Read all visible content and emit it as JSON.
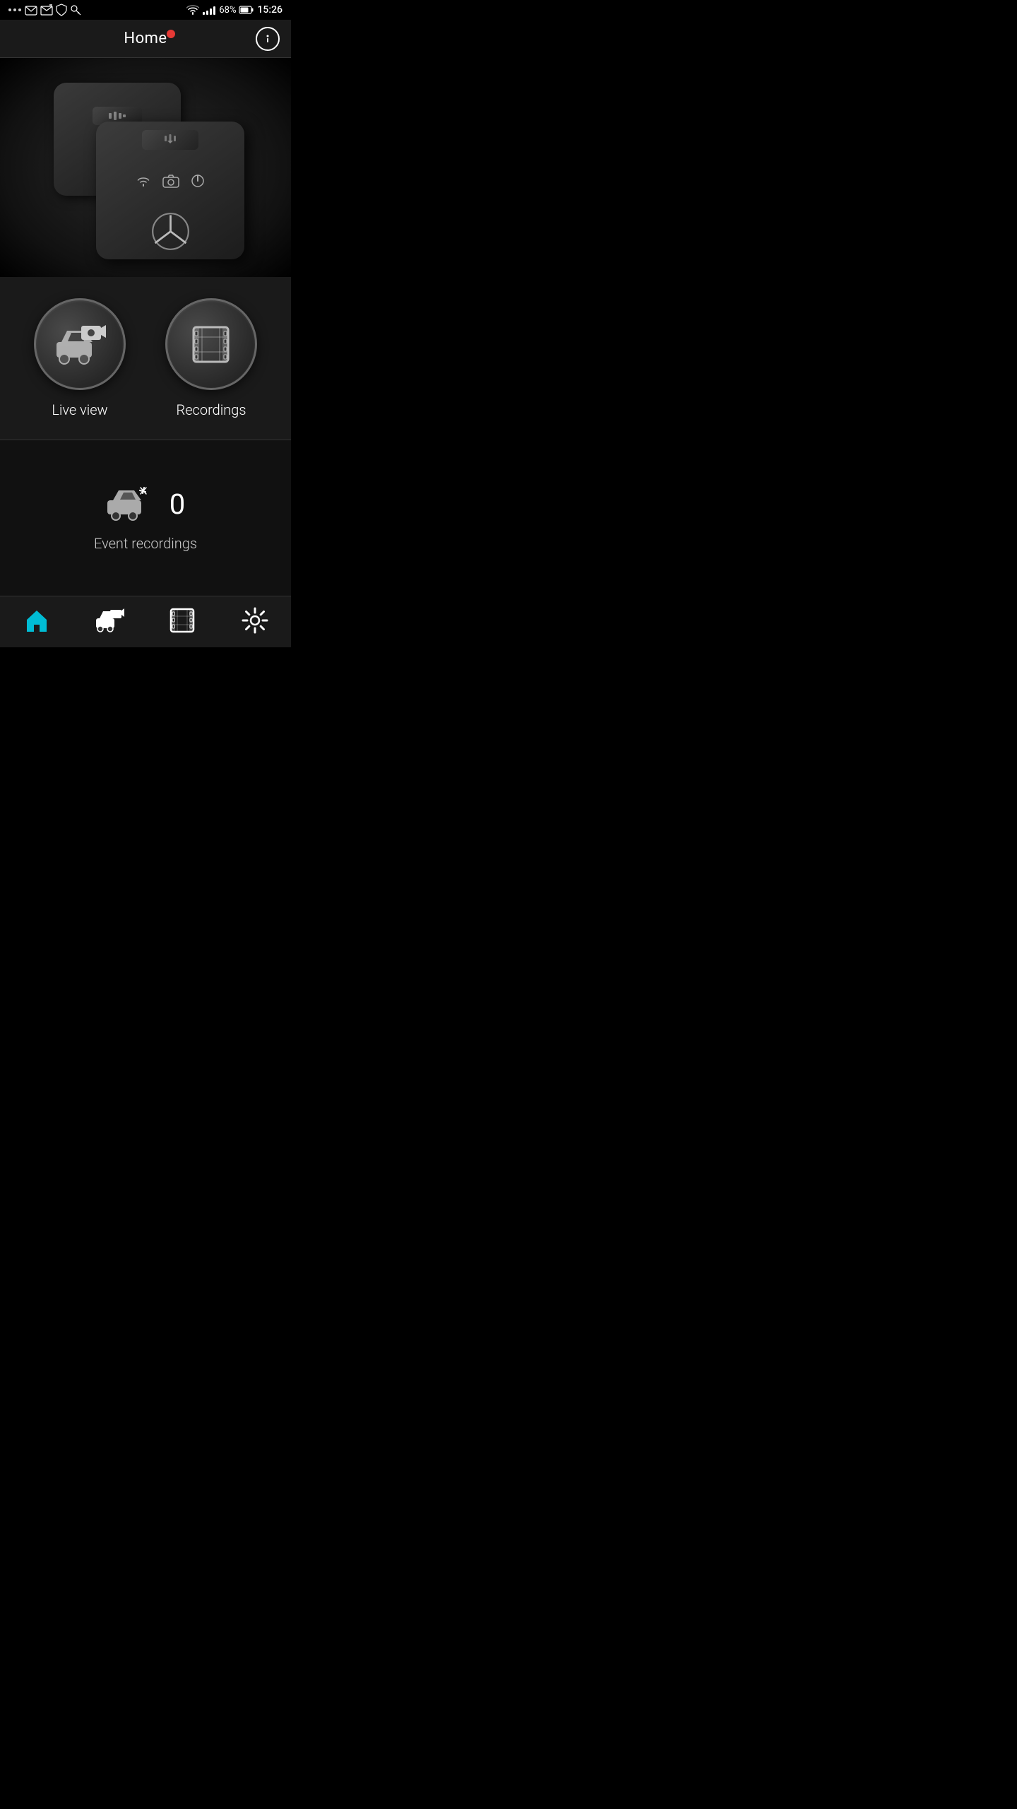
{
  "statusBar": {
    "battery": "68%",
    "time": "15:26",
    "icons": [
      "dots",
      "gmail",
      "email",
      "shield",
      "key"
    ]
  },
  "header": {
    "title": "Home",
    "hasNotificationDot": true,
    "infoButton": "ⓘ"
  },
  "deviceImage": {
    "altText": "Mercedes dashcam devices"
  },
  "actions": {
    "liveView": {
      "label": "Live view",
      "icon": "live-camera-car"
    },
    "recordings": {
      "label": "Recordings",
      "icon": "film-strip"
    }
  },
  "events": {
    "count": "0",
    "label": "Event recordings"
  },
  "bottomNav": {
    "items": [
      {
        "id": "home",
        "label": "",
        "icon": "home",
        "active": true
      },
      {
        "id": "liveview",
        "label": "",
        "icon": "live-camera",
        "active": false
      },
      {
        "id": "recordings",
        "label": "",
        "icon": "film",
        "active": false
      },
      {
        "id": "settings",
        "label": "",
        "icon": "gear",
        "active": false
      }
    ]
  }
}
